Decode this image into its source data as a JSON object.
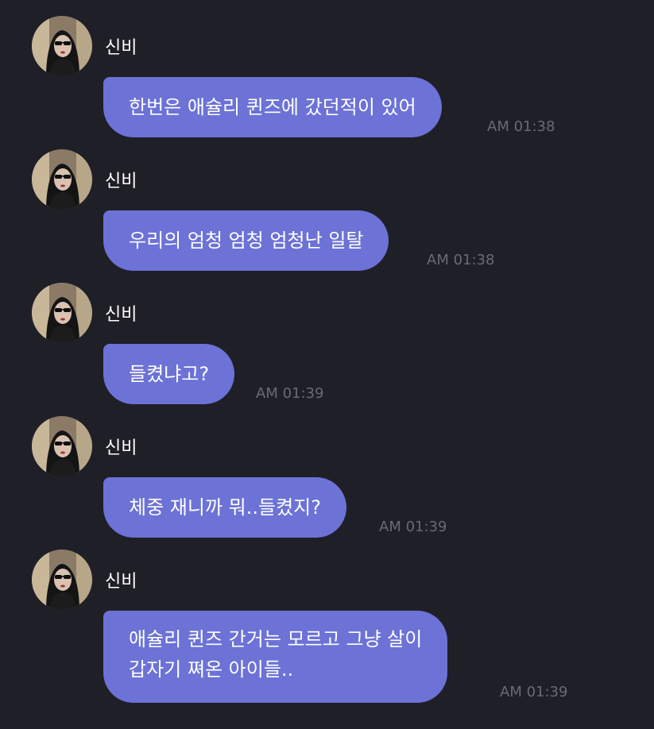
{
  "messages": [
    {
      "sender": "신비",
      "avatar": "sender-avatar",
      "lines": [
        "한번은 애슐리 퀸즈에 갔던적이 있어"
      ],
      "time": "AM 01:38"
    },
    {
      "sender": "신비",
      "avatar": "sender-avatar",
      "lines": [
        "우리의 엄청 엄청 엄청난 일탈"
      ],
      "time": "AM 01:38"
    },
    {
      "sender": "신비",
      "avatar": "sender-avatar",
      "lines": [
        "들켰냐고?"
      ],
      "time": "AM 01:39"
    },
    {
      "sender": "신비",
      "avatar": "sender-avatar",
      "lines": [
        "체중 재니까 뭐..들켰지?"
      ],
      "time": "AM 01:39"
    },
    {
      "sender": "신비",
      "avatar": "sender-avatar",
      "lines": [
        "애슐리 퀸즈 간거는 모르고 그냥 살이",
        "갑자기 쪄온 아이들.."
      ],
      "time": "AM 01:39"
    }
  ],
  "colors": {
    "background": "#1f1f27",
    "bubble": "#6c72d6",
    "timestamp": "#6a6a74",
    "sender_text": "#ffffff"
  }
}
